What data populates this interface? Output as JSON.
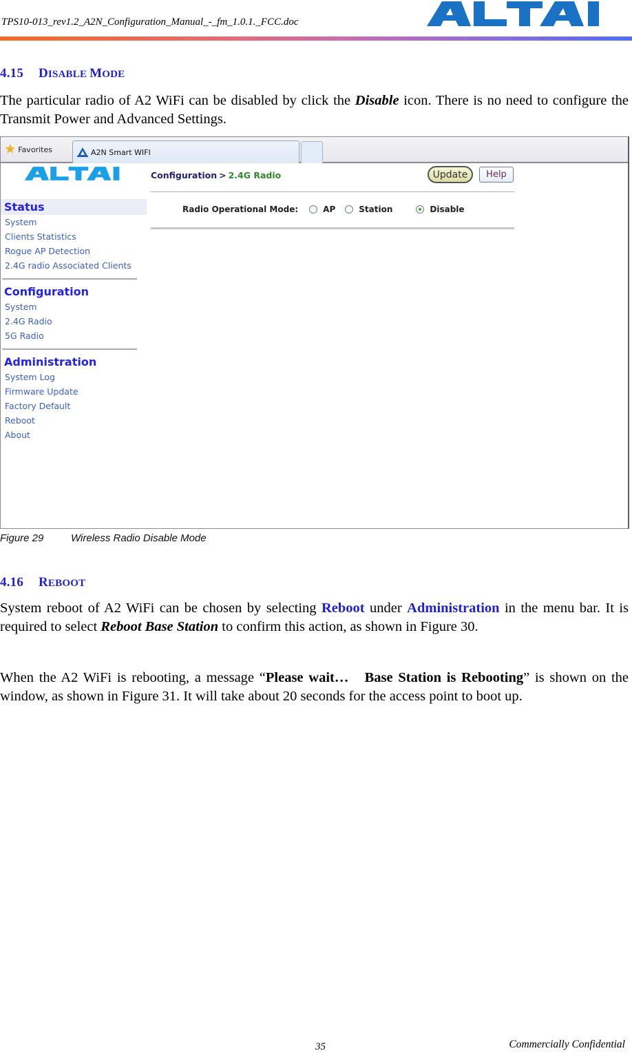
{
  "header": {
    "filename": "TPS10-013_rev1.2_A2N_Configuration_Manual_-_fm_1.0.1._FCC.doc",
    "logo_text": "ALTAI",
    "logo_color": "#1a72c4"
  },
  "section_415": {
    "number": "4.15",
    "title_cap1": "D",
    "title_rest1": "ISABLE ",
    "title_cap2": "M",
    "title_rest2": "ODE",
    "para_pre": "The particular radio of A2 WiFi can be disabled by click the ",
    "para_em": "Disable",
    "para_post": " icon. There is no need to configure the Transmit Power and Advanced Settings."
  },
  "screenshot": {
    "favorites_label": "Favorites",
    "tab_title": "A2N Smart WIFI",
    "logo_text": "ALTAI",
    "breadcrumb": {
      "root": "Configuration",
      "separator": ">",
      "leaf": "2.4G Radio"
    },
    "buttons": {
      "update": "Update",
      "help": "Help"
    },
    "mode": {
      "label": "Radio Operational Mode:",
      "options": [
        "AP",
        "Station",
        "Disable"
      ],
      "selected": "Disable"
    },
    "sidebar": {
      "status": {
        "heading": "Status",
        "items": [
          "System",
          "Clients Statistics",
          "Rogue AP Detection",
          "2.4G radio Associated Clients"
        ]
      },
      "configuration": {
        "heading": "Configuration",
        "items": [
          "System",
          "2.4G Radio",
          "5G Radio"
        ]
      },
      "administration": {
        "heading": "Administration",
        "items": [
          "System Log",
          "Firmware Update",
          "Factory Default",
          "Reboot",
          "About"
        ]
      }
    }
  },
  "caption": {
    "number": "Figure 29",
    "text": "Wireless Radio Disable Mode"
  },
  "section_416": {
    "number": "4.16",
    "title_cap": "R",
    "title_rest": "EBOOT",
    "p1_a": "System reboot of A2 WiFi can be chosen by selecting ",
    "p1_reboot": "Reboot",
    "p1_b": " under ",
    "p1_admin": "Administration",
    "p1_c": " in the menu bar. It is required to select ",
    "p1_em": "Reboot Base Station",
    "p1_d": " to confirm this action, as shown in Figure 30.",
    "p2_a": "When the A2 WiFi is rebooting, a message “",
    "p2_bold": "Please wait…   Base Station is Rebooting",
    "p2_b": "” is shown on the window, as shown in Figure 31. It will take about 20 seconds for the access point to boot up."
  },
  "footer": {
    "page_number": "35",
    "confidential": "Commercially Confidential"
  }
}
